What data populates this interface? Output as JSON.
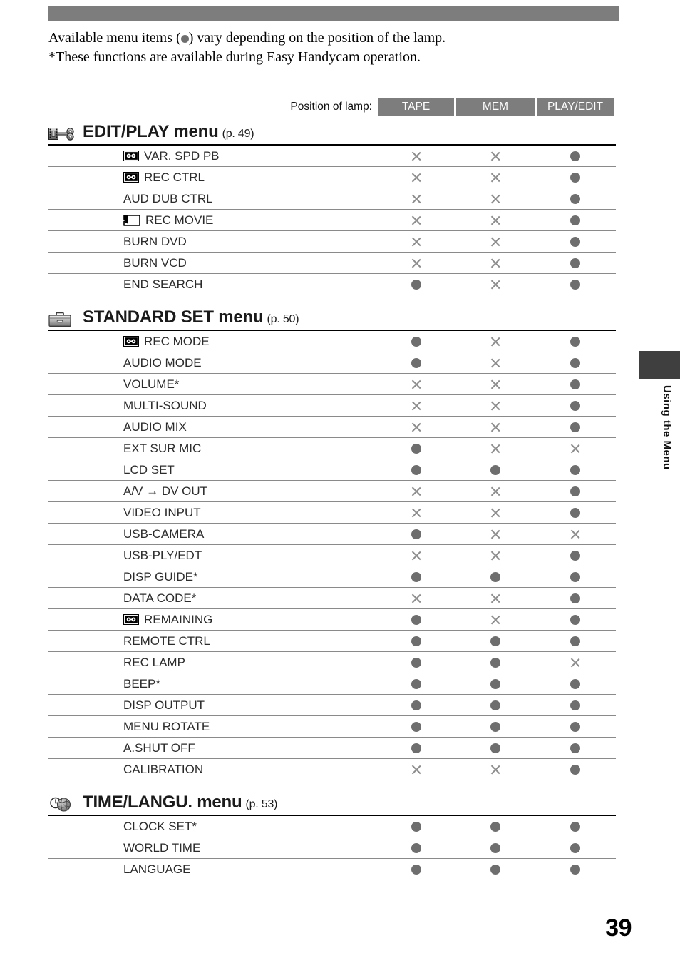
{
  "page": {
    "number": "39",
    "side_tab_label": "Using the Menu"
  },
  "intro": {
    "line1_before": "Available menu items (",
    "line1_after": ") vary depending on the position of the lamp.",
    "line2": "*These functions are available during Easy Handycam operation."
  },
  "table_header": {
    "label": "Position of lamp:",
    "columns": [
      "TAPE",
      "MEM",
      "PLAY/EDIT"
    ]
  },
  "legend": {
    "available_mark": "dot",
    "unavailable_mark": "cross"
  },
  "colors": {
    "band_gray": "#7d7d7d",
    "dot_gray": "#6e6e6e",
    "cross_gray": "#8d8d8d",
    "rule_gray": "#8a8a8a",
    "tab_dark": "#3f3f3f"
  },
  "sections": [
    {
      "icon": "edit-play-icon",
      "title": "EDIT/PLAY menu",
      "page_ref": "(p. 49)",
      "rows": [
        {
          "icon": "cassette-tape-icon",
          "label": "VAR. SPD PB",
          "marks": [
            "cross",
            "cross",
            "dot"
          ]
        },
        {
          "icon": "cassette-tape-icon",
          "label": "REC CTRL",
          "marks": [
            "cross",
            "cross",
            "dot"
          ]
        },
        {
          "icon": null,
          "label": "AUD DUB CTRL",
          "marks": [
            "cross",
            "cross",
            "dot"
          ]
        },
        {
          "icon": "memory-stick-icon",
          "label": "REC MOVIE",
          "marks": [
            "cross",
            "cross",
            "dot"
          ]
        },
        {
          "icon": null,
          "label": "BURN DVD",
          "marks": [
            "cross",
            "cross",
            "dot"
          ]
        },
        {
          "icon": null,
          "label": "BURN VCD",
          "marks": [
            "cross",
            "cross",
            "dot"
          ]
        },
        {
          "icon": null,
          "label": "END SEARCH",
          "marks": [
            "dot",
            "cross",
            "dot"
          ]
        }
      ]
    },
    {
      "icon": "toolbox-icon",
      "title": "STANDARD SET menu",
      "page_ref": "(p. 50)",
      "rows": [
        {
          "icon": "cassette-tape-icon",
          "label": "REC MODE",
          "marks": [
            "dot",
            "cross",
            "dot"
          ]
        },
        {
          "icon": null,
          "label": "AUDIO MODE",
          "marks": [
            "dot",
            "cross",
            "dot"
          ]
        },
        {
          "icon": null,
          "label": "VOLUME*",
          "marks": [
            "cross",
            "cross",
            "dot"
          ]
        },
        {
          "icon": null,
          "label": "MULTI-SOUND",
          "marks": [
            "cross",
            "cross",
            "dot"
          ]
        },
        {
          "icon": null,
          "label": "AUDIO MIX",
          "marks": [
            "cross",
            "cross",
            "dot"
          ]
        },
        {
          "icon": null,
          "label": "EXT SUR MIC",
          "marks": [
            "dot",
            "cross",
            "cross"
          ]
        },
        {
          "icon": null,
          "label": "LCD SET",
          "marks": [
            "dot",
            "dot",
            "dot"
          ]
        },
        {
          "icon": null,
          "label": "A/V → DV OUT",
          "marks": [
            "cross",
            "cross",
            "dot"
          ]
        },
        {
          "icon": null,
          "label": "VIDEO INPUT",
          "marks": [
            "cross",
            "cross",
            "dot"
          ]
        },
        {
          "icon": null,
          "label": "USB-CAMERA",
          "marks": [
            "dot",
            "cross",
            "cross"
          ]
        },
        {
          "icon": null,
          "label": "USB-PLY/EDT",
          "marks": [
            "cross",
            "cross",
            "dot"
          ]
        },
        {
          "icon": null,
          "label": "DISP GUIDE*",
          "marks": [
            "dot",
            "dot",
            "dot"
          ]
        },
        {
          "icon": null,
          "label": "DATA CODE*",
          "marks": [
            "cross",
            "cross",
            "dot"
          ]
        },
        {
          "icon": "cassette-tape-icon",
          "label": "REMAINING",
          "marks": [
            "dot",
            "cross",
            "dot"
          ]
        },
        {
          "icon": null,
          "label": "REMOTE CTRL",
          "marks": [
            "dot",
            "dot",
            "dot"
          ]
        },
        {
          "icon": null,
          "label": "REC LAMP",
          "marks": [
            "dot",
            "dot",
            "cross"
          ]
        },
        {
          "icon": null,
          "label": "BEEP*",
          "marks": [
            "dot",
            "dot",
            "dot"
          ]
        },
        {
          "icon": null,
          "label": "DISP OUTPUT",
          "marks": [
            "dot",
            "dot",
            "dot"
          ]
        },
        {
          "icon": null,
          "label": "MENU ROTATE",
          "marks": [
            "dot",
            "dot",
            "dot"
          ]
        },
        {
          "icon": null,
          "label": "A.SHUT OFF",
          "marks": [
            "dot",
            "dot",
            "dot"
          ]
        },
        {
          "icon": null,
          "label": "CALIBRATION",
          "marks": [
            "cross",
            "cross",
            "dot"
          ]
        }
      ]
    },
    {
      "icon": "clock-globe-icon",
      "title": "TIME/LANGU. menu",
      "page_ref": "(p. 53)",
      "rows": [
        {
          "icon": null,
          "label": "CLOCK SET*",
          "marks": [
            "dot",
            "dot",
            "dot"
          ]
        },
        {
          "icon": null,
          "label": "WORLD TIME",
          "marks": [
            "dot",
            "dot",
            "dot"
          ]
        },
        {
          "icon": null,
          "label": "LANGUAGE",
          "marks": [
            "dot",
            "dot",
            "dot"
          ]
        }
      ]
    }
  ]
}
